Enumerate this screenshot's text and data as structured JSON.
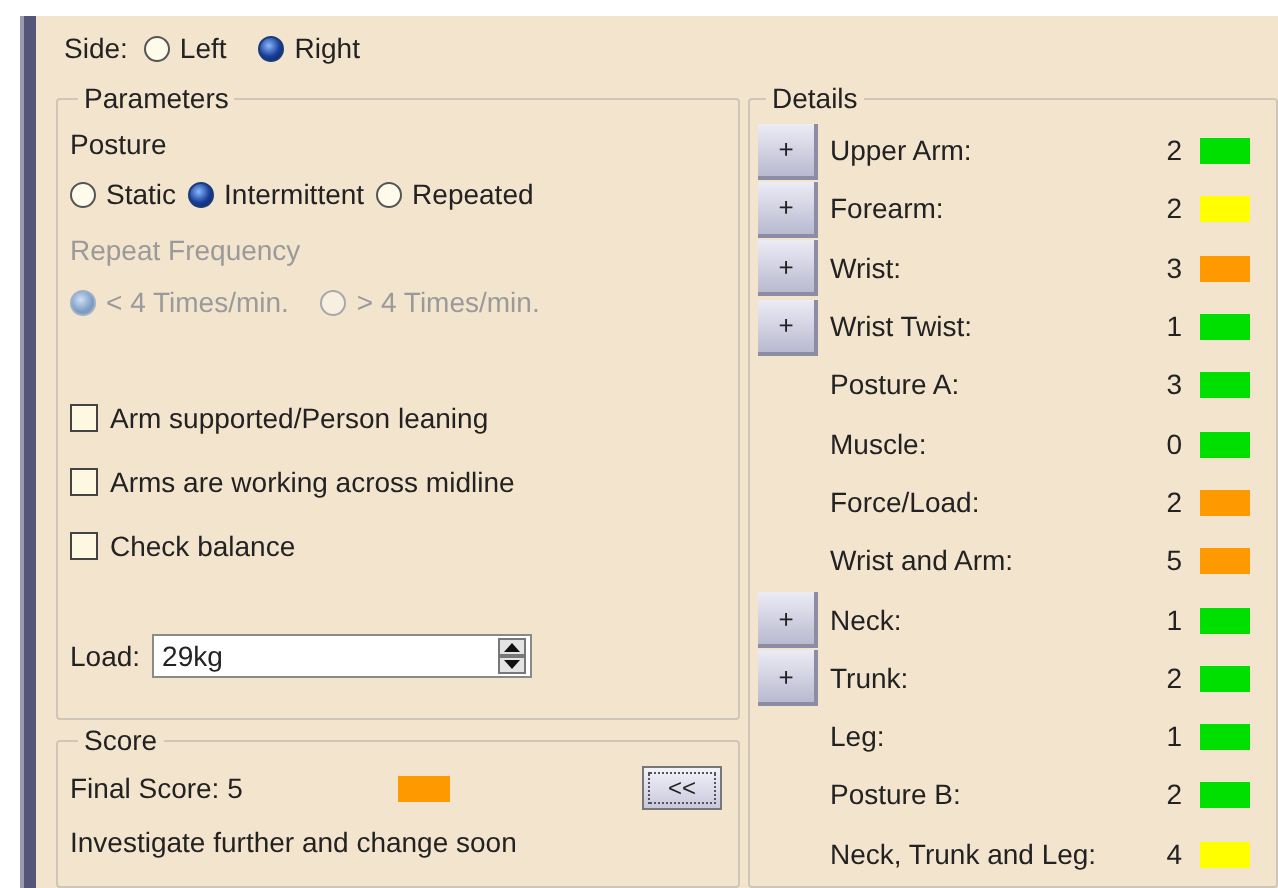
{
  "side": {
    "label": "Side:",
    "options": [
      {
        "label": "Left",
        "selected": false
      },
      {
        "label": "Right",
        "selected": true
      }
    ]
  },
  "parameters": {
    "title": "Parameters",
    "posture": {
      "label": "Posture",
      "options": [
        {
          "label": "Static",
          "selected": false
        },
        {
          "label": "Intermittent",
          "selected": true
        },
        {
          "label": "Repeated",
          "selected": false
        }
      ]
    },
    "repeat_frequency": {
      "label": "Repeat Frequency",
      "disabled": true,
      "options": [
        {
          "label": "< 4 Times/min.",
          "selected": true
        },
        {
          "label": "> 4 Times/min.",
          "selected": false
        }
      ]
    },
    "checkboxes": [
      {
        "label": "Arm supported/Person leaning",
        "checked": false
      },
      {
        "label": "Arms are working across midline",
        "checked": false
      },
      {
        "label": "Check balance",
        "checked": false
      }
    ],
    "load": {
      "label": "Load:",
      "value": "29kg"
    }
  },
  "score": {
    "title": "Score",
    "final_score": "Final Score: 5",
    "color": "#ff9900",
    "button": "<<",
    "message": "Investigate further and change soon"
  },
  "details": {
    "title": "Details",
    "rows": [
      {
        "button": "+",
        "label": "Upper Arm:",
        "value": "2",
        "color": "#00e000"
      },
      {
        "button": "+",
        "label": "Forearm:",
        "value": "2",
        "color": "#ffff00"
      },
      {
        "button": "+",
        "label": "Wrist:",
        "value": "3",
        "color": "#ff9900"
      },
      {
        "button": "+",
        "label": "Wrist Twist:",
        "value": "1",
        "color": "#00e000"
      },
      {
        "label": "Posture A:",
        "value": "3",
        "color": "#00e000"
      },
      {
        "label": "Muscle:",
        "value": "0",
        "color": "#00e000"
      },
      {
        "label": "Force/Load:",
        "value": "2",
        "color": "#ff9900"
      },
      {
        "label": "Wrist and Arm:",
        "value": "5",
        "color": "#ff9900"
      },
      {
        "button": "+",
        "label": "Neck:",
        "value": "1",
        "color": "#00e000"
      },
      {
        "button": "+",
        "label": "Trunk:",
        "value": "2",
        "color": "#00e000"
      },
      {
        "label": "Leg:",
        "value": "1",
        "color": "#00e000"
      },
      {
        "label": "Posture B:",
        "value": "2",
        "color": "#00e000"
      },
      {
        "label": "Neck, Trunk and Leg:",
        "value": "4",
        "color": "#ffff00"
      }
    ]
  }
}
